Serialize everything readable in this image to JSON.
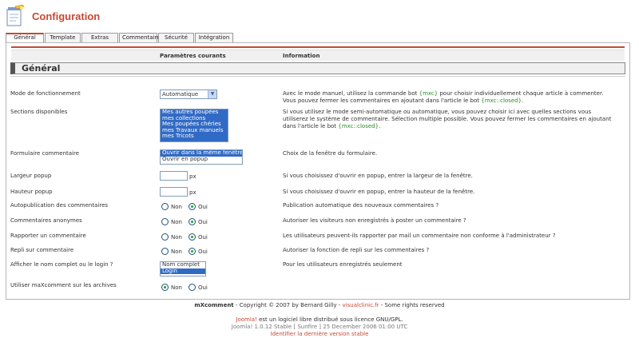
{
  "header": {
    "title": "Configuration",
    "icon": "notepad-pencil-icon"
  },
  "tabs": [
    "Général",
    "Template",
    "Extras",
    "Commentaire",
    "Sécurité",
    "Intégration"
  ],
  "table": {
    "col_params": "Paramètres courants",
    "col_info": "Information",
    "section_title": "Général"
  },
  "rows": {
    "mode": {
      "label": "Mode de fonctionnement",
      "value": "Automatique",
      "info_a": "Avec le mode manuel, utilisez la commande bot ",
      "info_code1": "{mxc}",
      "info_b": " pour choisir individuellement chaque article à commenter. Vous pouvez fermer les commentaires en ajoutant dans l'article le bot ",
      "info_code2": "{mxc::closed}",
      "info_c": "."
    },
    "sections": {
      "label": "Sections disponibles",
      "options": [
        "Mes autres poupées",
        "mes collections",
        "Mes poupées chéries",
        "mes Travaux manuels",
        "mes Tricots"
      ],
      "info_a": "Si vous utilisez le mode semi-automatique ou automatique, vous pouvez choisir ici avec quelles sections vous utiliserez le système de commentaire. Sélection multiple possible. Vous pouvez fermer les commentaires en ajoutant dans l'article le bot ",
      "info_code": "{mxc::closed}",
      "info_b": "."
    },
    "form": {
      "label": "Formulaire commentaire",
      "options": [
        "Ouvrir dans la même fenêtre",
        "Ouvrir en popup"
      ],
      "info": "Choix de la fenêtre du formulaire."
    },
    "popup_width": {
      "label": "Largeur popup",
      "value": "",
      "unit": "px",
      "info": "Si vous choisissez d'ouvrir en popup, entrer la largeur de la fenêtre."
    },
    "popup_height": {
      "label": "Hauteur popup",
      "value": "",
      "unit": "px",
      "info": "Si vous choisissez d'ouvrir en popup, entrer la hauteur de la fenêtre."
    },
    "autopub": {
      "label": "Autopublication des commentaires",
      "no": "Non",
      "yes": "Oui",
      "info": "Publication automatique des nouveaux commentaires ?"
    },
    "anon": {
      "label": "Commentaires anonymes",
      "no": "Non",
      "yes": "Oui",
      "info": "Autoriser les visiteurs non enregistrés à poster un commentaire ?"
    },
    "report": {
      "label": "Rapporter un commentaire",
      "no": "Non",
      "yes": "Oui",
      "info": "Les utilisateurs peuvent-ils rapporter par mail un commentaire non conforme à l'administrateur ?"
    },
    "reply": {
      "label": "Repli sur commentaire",
      "no": "Non",
      "yes": "Oui",
      "info": "Autoriser la fonction de repli sur les commentaires ?"
    },
    "name": {
      "label": "Afficher le nom complet ou le login ?",
      "options": [
        "Nom complet",
        "Login"
      ],
      "info": "Pour les utilisateurs enregistrés seulement"
    },
    "archives": {
      "label": "Utiliser maXcomment sur les archives",
      "no": "Non",
      "yes": "Oui"
    }
  },
  "footer": {
    "product": "mXcomment",
    "copyright": " - Copyright © 2007 by Bernard Gilly - ",
    "site": "visualclinic.fr",
    "rights": " - Some rights reserved",
    "joomla": "Joomla!",
    "license": " est un logiciel libre distribué sous licence GNU/GPL.",
    "version": "Joomla! 1.0.12 Stable [ Sunfire ] 25 December 2006 01:00 UTC",
    "check": "Identifier la dernière version stable"
  },
  "colors": {
    "accent": "#c64934",
    "code": "#2a8a2a",
    "selection": "#316ac5"
  }
}
